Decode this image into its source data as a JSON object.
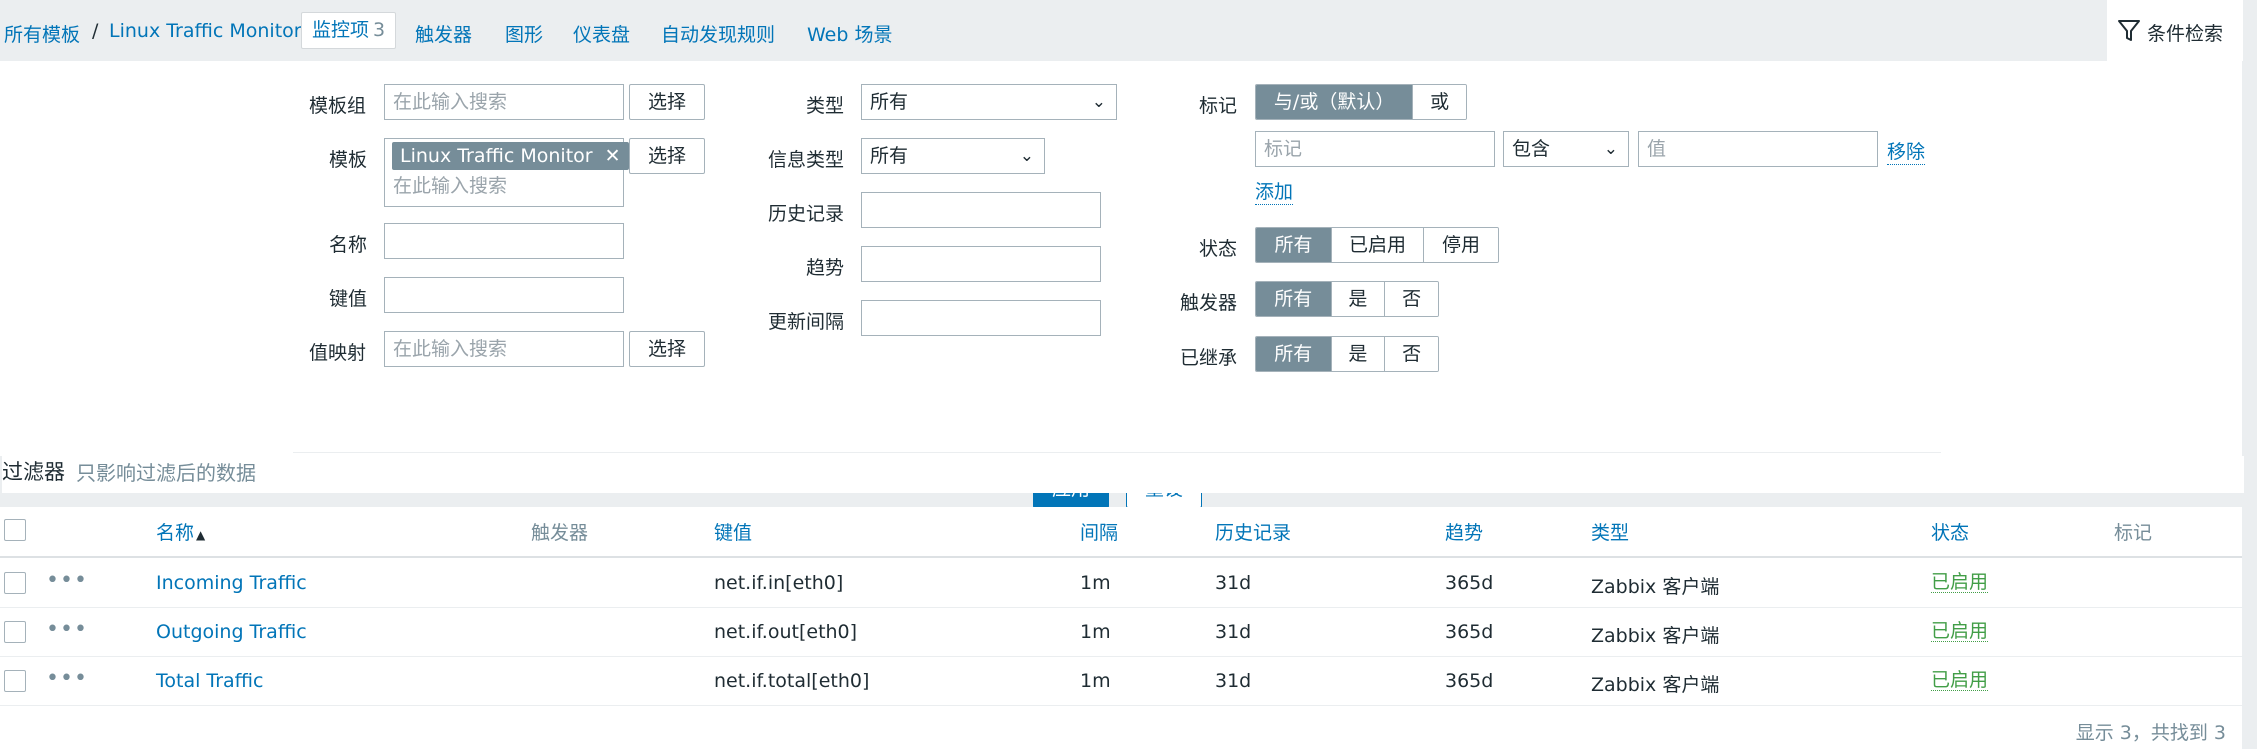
{
  "nav": {
    "breadcrumb_root": "所有模板",
    "separator": "/",
    "breadcrumb_template": "Linux Traffic Monitor",
    "tab_items": "监控项",
    "tab_items_count": "3",
    "tab_triggers": "触发器",
    "tab_graphs": "图形",
    "tab_dashboards": "仪表盘",
    "tab_discovery": "自动发现规则",
    "tab_web": "Web 场景",
    "filter_toggle": "条件检索"
  },
  "filter": {
    "host_group_label": "模板组",
    "host_group_placeholder": "在此输入搜索",
    "select_label": "选择",
    "template_label": "模板",
    "template_chip": "Linux Traffic Monitor",
    "template_placeholder": "在此输入搜索",
    "name_label": "名称",
    "key_label": "键值",
    "valuemap_label": "值映射",
    "valuemap_placeholder": "在此输入搜索",
    "type_label": "类型",
    "type_value": "所有",
    "info_type_label": "信息类型",
    "info_type_value": "所有",
    "history_label": "历史记录",
    "trends_label": "趋势",
    "interval_label": "更新间隔",
    "tags_label": "标记",
    "tags_and_or": "与/或（默认）",
    "tags_or": "或",
    "tag_name_placeholder": "标记",
    "tag_operator": "包含",
    "tag_value_placeholder": "值",
    "tag_remove": "移除",
    "tag_add": "添加",
    "state_label": "状态",
    "state_options": [
      "所有",
      "已启用",
      "停用"
    ],
    "triggers_label": "触发器",
    "triggers_options": [
      "所有",
      "是",
      "否"
    ],
    "inherited_label": "已继承",
    "inherited_options": [
      "所有",
      "是",
      "否"
    ],
    "apply": "应用",
    "reset": "重设",
    "caption_title": "过滤器",
    "caption_sub": "只影响过滤后的数据"
  },
  "table": {
    "headers": {
      "name": "名称",
      "sort_arrow": "▲",
      "triggers": "触发器",
      "key": "键值",
      "interval": "间隔",
      "history": "历史记录",
      "trends": "趋势",
      "type": "类型",
      "status": "状态",
      "tags": "标记"
    },
    "rows": [
      {
        "name": "Incoming Traffic",
        "key": "net.if.in[eth0]",
        "interval": "1m",
        "history": "31d",
        "trends": "365d",
        "type": "Zabbix 客户端",
        "status": "已启用"
      },
      {
        "name": "Outgoing Traffic",
        "key": "net.if.out[eth0]",
        "interval": "1m",
        "history": "31d",
        "trends": "365d",
        "type": "Zabbix 客户端",
        "status": "已启用"
      },
      {
        "name": "Total Traffic",
        "key": "net.if.total[eth0]",
        "interval": "1m",
        "history": "31d",
        "trends": "365d",
        "type": "Zabbix 客户端",
        "status": "已启用"
      }
    ],
    "footer": "显示 3，共找到 3"
  }
}
